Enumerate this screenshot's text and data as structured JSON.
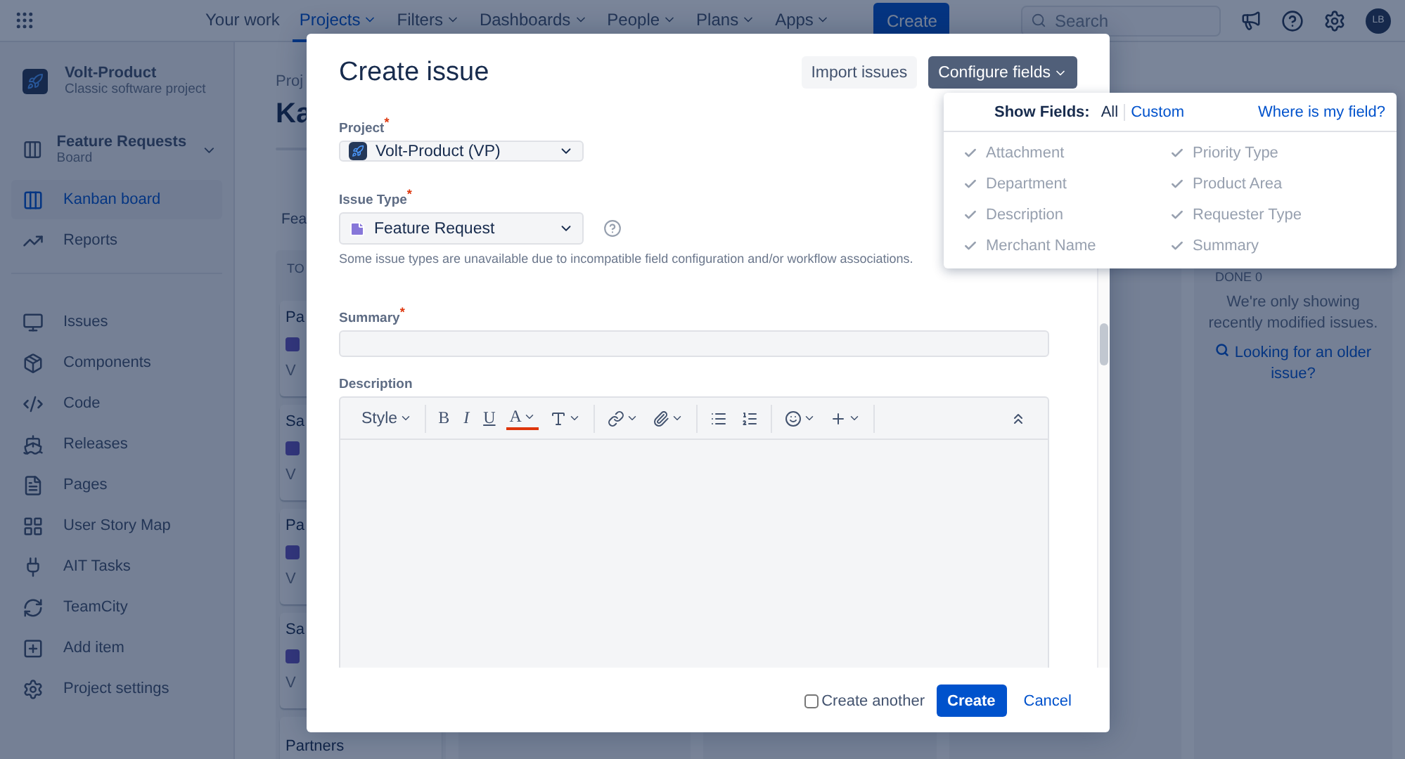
{
  "topbar": {
    "nav": [
      {
        "label": "Your work",
        "selected": false,
        "menu": false
      },
      {
        "label": "Projects",
        "selected": true,
        "menu": true
      },
      {
        "label": "Filters",
        "selected": false,
        "menu": true
      },
      {
        "label": "Dashboards",
        "selected": false,
        "menu": true
      },
      {
        "label": "People",
        "selected": false,
        "menu": true
      },
      {
        "label": "Plans",
        "selected": false,
        "menu": true
      },
      {
        "label": "Apps",
        "selected": false,
        "menu": true
      }
    ],
    "create_button": "Create",
    "search": {
      "placeholder": "Search"
    },
    "avatar": "LB"
  },
  "sidebar": {
    "project": {
      "name": "Volt-Product",
      "subtitle": "Classic software project"
    },
    "board": {
      "name": "Feature Requests",
      "subtitle": "Board"
    },
    "items": [
      {
        "kind": "board",
        "label": "Kanban board",
        "selected": true
      },
      {
        "kind": "reports",
        "label": "Reports",
        "selected": false
      }
    ],
    "more_items": [
      {
        "kind": "issues",
        "label": "Issues",
        "selected": false
      },
      {
        "kind": "components",
        "label": "Components",
        "selected": false
      },
      {
        "kind": "code",
        "label": "Code",
        "selected": false
      },
      {
        "kind": "releases",
        "label": "Releases",
        "selected": false
      },
      {
        "kind": "pages",
        "label": "Pages",
        "selected": false
      },
      {
        "kind": "map",
        "label": "User Story Map",
        "selected": false
      },
      {
        "kind": "plugin",
        "label": "AIT Tasks",
        "selected": false
      },
      {
        "kind": "sync",
        "label": "TeamCity",
        "selected": false
      },
      {
        "kind": "add",
        "label": "Add item",
        "selected": false
      },
      {
        "kind": "settings",
        "label": "Project settings",
        "selected": false
      }
    ]
  },
  "board": {
    "breadcrumb": "Proj",
    "title": "Ka",
    "filter": "Fea",
    "column_header": "TO",
    "cards": [
      {
        "title": "Pa",
        "key": "V"
      },
      {
        "title": "Sa",
        "key": "V"
      },
      {
        "title": "Pa",
        "key": "V"
      },
      {
        "title": "Sa",
        "key": "V"
      }
    ],
    "last_card": "Partners",
    "done_column": {
      "header": "DONE 0",
      "message": "We're only showing recently modified issues.",
      "link": "Looking for an older issue?"
    }
  },
  "modal": {
    "title": "Create issue",
    "import_button": "Import issues",
    "configure_button": "Configure fields",
    "project": {
      "label": "Project$^{*}$",
      "value": "Volt-Product (VP)"
    },
    "issue_type": {
      "label": "Issue Type$^{*}$",
      "value": "Feature Request",
      "hint": "Some issue types are unavailable due to incompatible field configuration and/or workflow associations."
    },
    "summary": {
      "label": "Summary$^{*}$"
    },
    "description": {
      "label": "Description",
      "toolbar": [
        [
          {
            "kind": "style",
            "label": "Style",
            "menu": true
          }
        ],
        [
          {
            "kind": "bold",
            "label": "B",
            "menu": false
          },
          {
            "kind": "italic",
            "label": "I",
            "menu": false
          },
          {
            "kind": "underline",
            "label": "U",
            "menu": false
          },
          {
            "kind": "color",
            "label": "A",
            "menu": true
          },
          {
            "kind": "size",
            "menu": true
          }
        ],
        [
          {
            "kind": "link",
            "menu": true
          },
          {
            "kind": "attach",
            "menu": true
          }
        ],
        [
          {
            "kind": "bullets",
            "menu": false
          },
          {
            "kind": "numbers",
            "menu": false
          }
        ],
        [
          {
            "kind": "emoji",
            "menu": true
          },
          {
            "kind": "insert",
            "menu": true
          }
        ],
        [
          {
            "kind": "collapse",
            "menu": false
          }
        ]
      ]
    },
    "create_another": {
      "label": "Create another",
      "checked": false
    },
    "create_button": "Create",
    "cancel_link": "Cancel"
  },
  "fields_menu": {
    "show_label": "Show Fields:",
    "options": [
      {
        "label": "All",
        "selected": true
      },
      {
        "label": "Custom",
        "selected": false
      }
    ],
    "help_link": "Where is my field?",
    "fields": [
      {
        "label": "Attachment",
        "checked": true,
        "disabled": true
      },
      {
        "label": "Priority Type",
        "checked": true,
        "disabled": true
      },
      {
        "label": "Department",
        "checked": true,
        "disabled": true
      },
      {
        "label": "Product Area",
        "checked": true,
        "disabled": true
      },
      {
        "label": "Description",
        "checked": true,
        "disabled": true
      },
      {
        "label": "Requester Type",
        "checked": true,
        "disabled": true
      },
      {
        "label": "Merchant Name",
        "checked": true,
        "disabled": true
      },
      {
        "label": "Summary",
        "checked": true,
        "disabled": true
      }
    ]
  }
}
